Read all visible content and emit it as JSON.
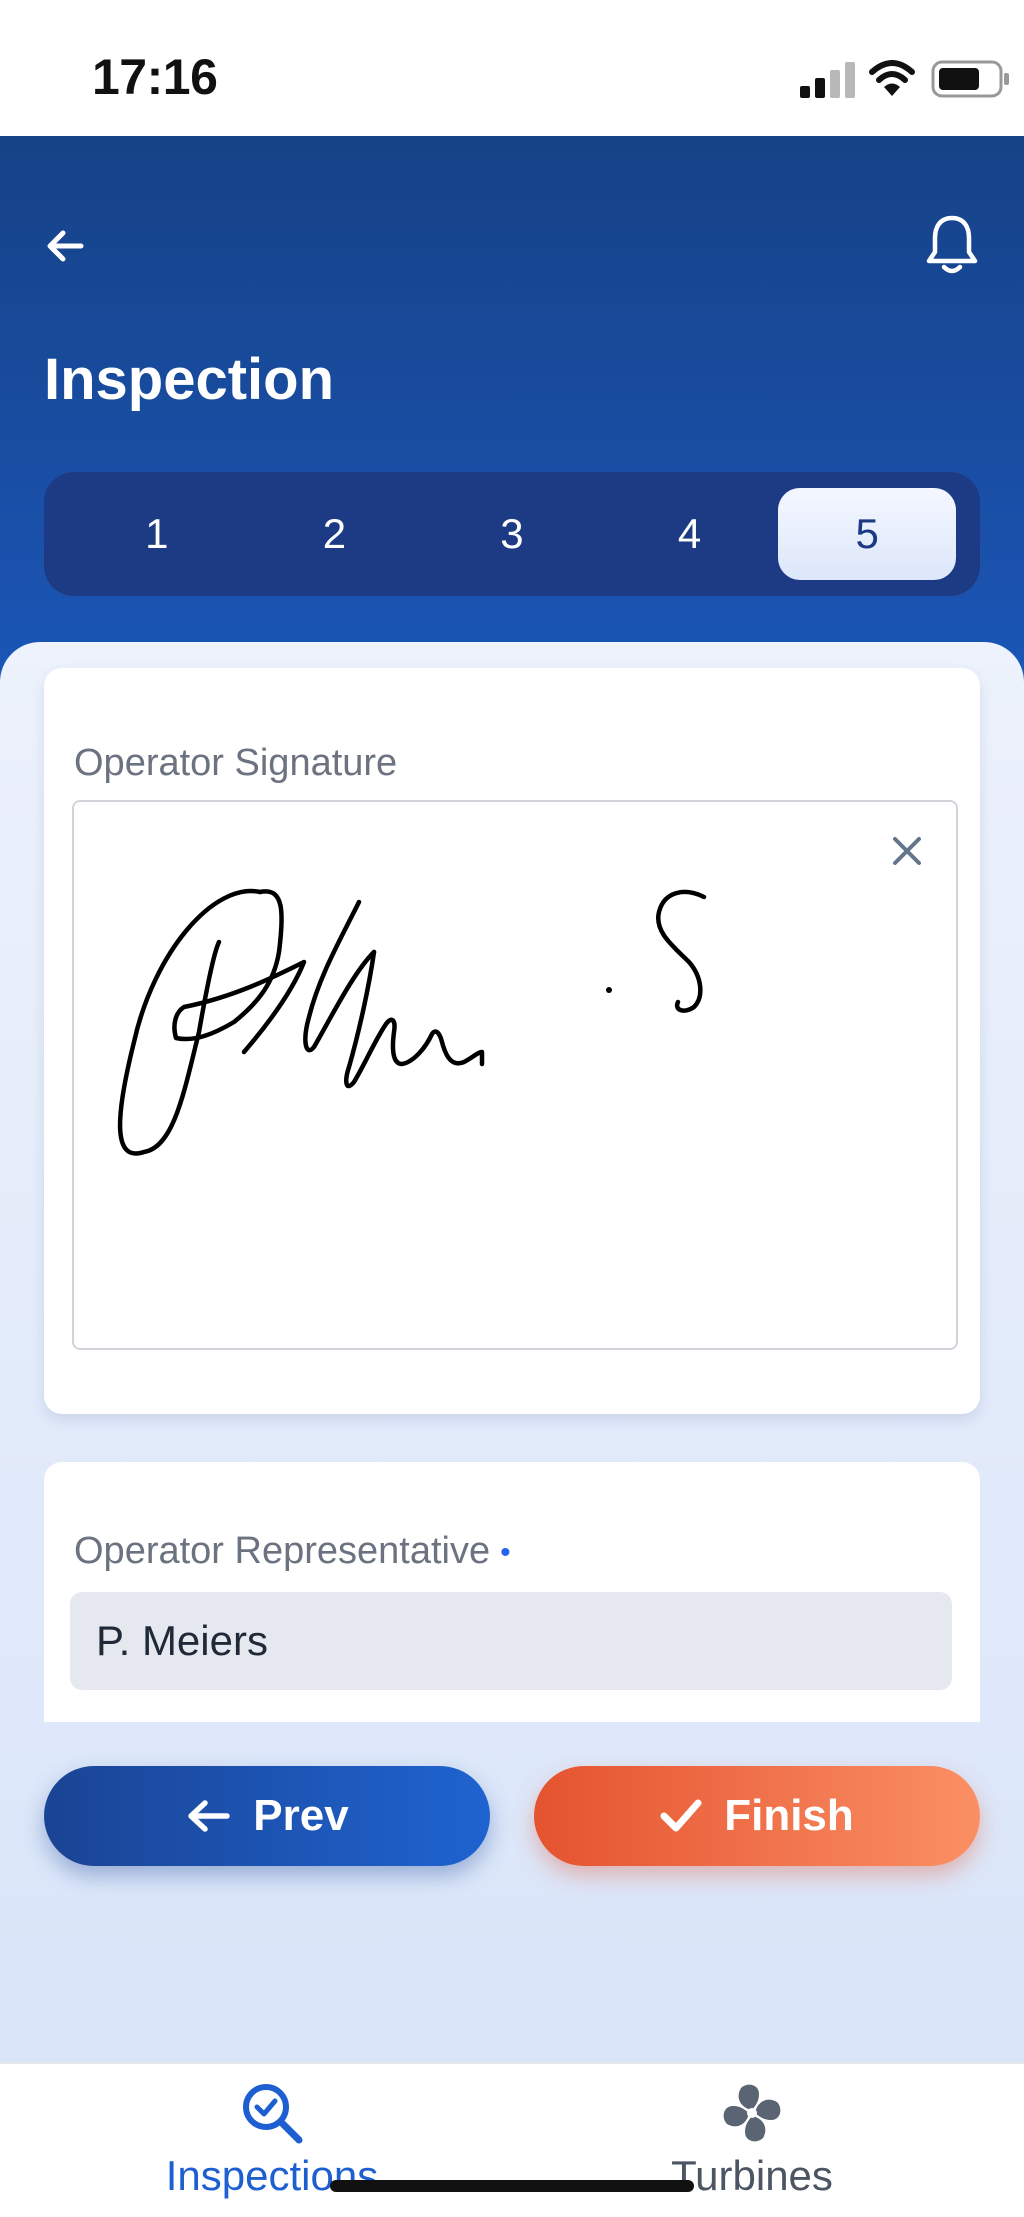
{
  "status_bar": {
    "time": "17:16"
  },
  "header": {
    "title": "Inspection",
    "steps": [
      "1",
      "2",
      "3",
      "4",
      "5"
    ],
    "active_step": "5"
  },
  "signature_card": {
    "label": "Operator Signature"
  },
  "representative_card": {
    "label": "Operator Representative",
    "required_marker": "•",
    "value": "P. Meiers"
  },
  "actions": {
    "prev_label": "Prev",
    "finish_label": "Finish"
  },
  "tabs": [
    {
      "label": "Inspections",
      "icon": "inspection-search-icon",
      "active": true
    },
    {
      "label": "Turbines",
      "icon": "turbine-fan-icon",
      "active": false
    }
  ],
  "colors": {
    "header_blue": "#164287",
    "stepper_dark": "#1d3a85",
    "prev_blue": "#1f63d0",
    "finish_orange": "#e4532f",
    "tab_active": "#1d5fd0"
  }
}
